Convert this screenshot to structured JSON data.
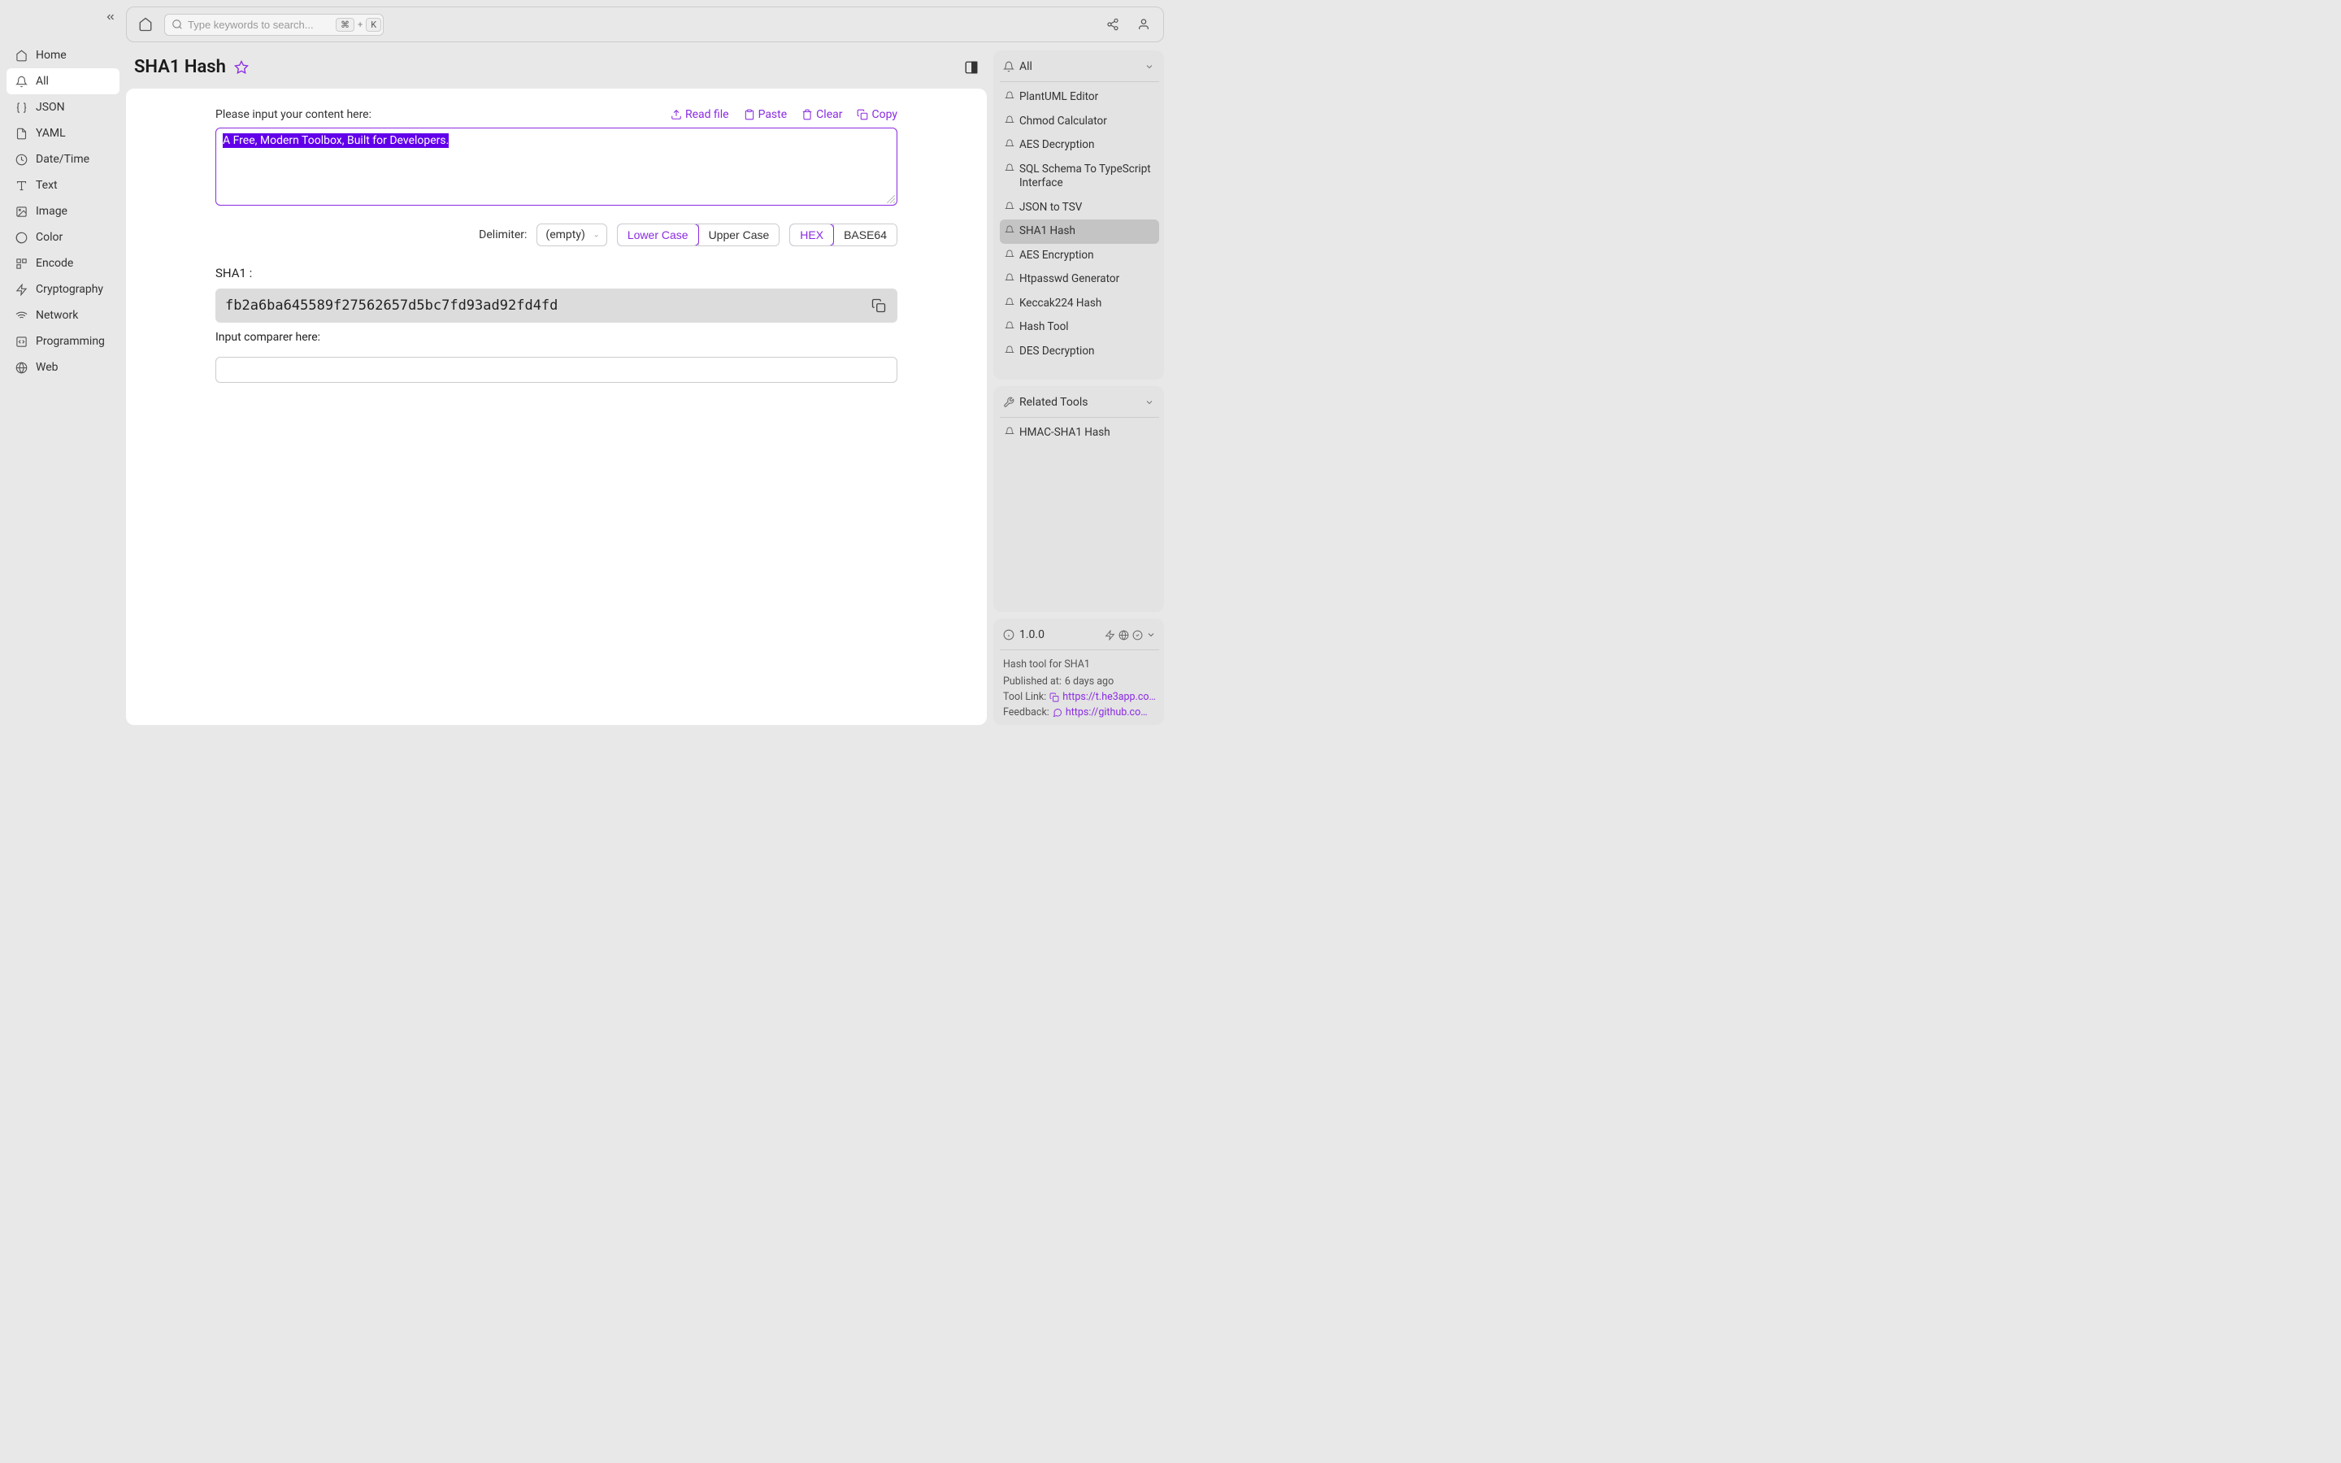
{
  "sidebar": {
    "items": [
      {
        "label": "Home",
        "icon": "home"
      },
      {
        "label": "All",
        "icon": "bell",
        "active": true
      },
      {
        "label": "JSON",
        "icon": "braces"
      },
      {
        "label": "YAML",
        "icon": "file"
      },
      {
        "label": "Date/Time",
        "icon": "clock"
      },
      {
        "label": "Text",
        "icon": "text"
      },
      {
        "label": "Image",
        "icon": "image"
      },
      {
        "label": "Color",
        "icon": "palette"
      },
      {
        "label": "Encode",
        "icon": "grid"
      },
      {
        "label": "Cryptography",
        "icon": "bolt"
      },
      {
        "label": "Network",
        "icon": "wifi"
      },
      {
        "label": "Programming",
        "icon": "code"
      },
      {
        "label": "Web",
        "icon": "globe"
      }
    ]
  },
  "search": {
    "placeholder": "Type keywords to search...",
    "kbd1": "⌘",
    "kbd_plus": "+",
    "kbd2": "K"
  },
  "tool": {
    "title": "SHA1 Hash",
    "input_label": "Please input your content here:",
    "actions": {
      "read_file": "Read file",
      "paste": "Paste",
      "clear": "Clear",
      "copy": "Copy"
    },
    "input_value": "A Free, Modern Toolbox, Built for Developers.",
    "delimiter_label": "Delimiter:",
    "delimiter_value": "(empty)",
    "case_lower": "Lower Case",
    "case_upper": "Upper Case",
    "fmt_hex": "HEX",
    "fmt_b64": "BASE64",
    "output_label": "SHA1 :",
    "output_value": "fb2a6ba645589f27562657d5bc7fd93ad92fd4fd",
    "compare_label": "Input comparer here:",
    "compare_value": ""
  },
  "right": {
    "all_label": "All",
    "tools": [
      {
        "label": "PlantUML Editor"
      },
      {
        "label": "Chmod Calculator"
      },
      {
        "label": "AES Decryption"
      },
      {
        "label": "SQL Schema To TypeScript Interface"
      },
      {
        "label": "JSON to TSV"
      },
      {
        "label": "SHA1 Hash",
        "active": true
      },
      {
        "label": "AES Encryption"
      },
      {
        "label": "Htpasswd Generator"
      },
      {
        "label": "Keccak224 Hash"
      },
      {
        "label": "Hash Tool"
      },
      {
        "label": "DES Decryption"
      }
    ],
    "related_label": "Related Tools",
    "related": [
      {
        "label": "HMAC-SHA1 Hash"
      }
    ],
    "info": {
      "version": "1.0.0",
      "desc": "Hash tool for SHA1",
      "published_label": "Published at:",
      "published_value": "6 days ago",
      "tool_link_label": "Tool Link:",
      "tool_link_value": "https://t.he3app.co…",
      "feedback_label": "Feedback:",
      "feedback_value": "https://github.com/…"
    }
  }
}
